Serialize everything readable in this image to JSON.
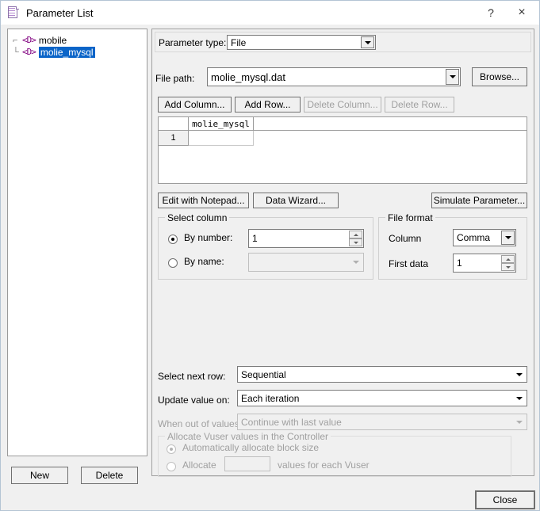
{
  "window": {
    "title": "Parameter List",
    "icon": "parameter-list-icon",
    "help_label": "?",
    "close_glyph": "×"
  },
  "tree": {
    "items": [
      {
        "label": "mobile",
        "glyph": "<D>",
        "selected": false
      },
      {
        "label": "molie_mysql",
        "glyph": "<D>",
        "selected": true
      }
    ]
  },
  "left_buttons": {
    "new_label": "New",
    "delete_label": "Delete"
  },
  "parameter_type": {
    "label": "Parameter type:",
    "value": "File"
  },
  "file_path": {
    "label": "File path:",
    "value": "molie_mysql.dat",
    "browse_label": "Browse..."
  },
  "table_toolbar": {
    "add_column": "Add Column...",
    "add_row": "Add Row...",
    "delete_column": "Delete Column...",
    "delete_row": "Delete Row..."
  },
  "grid": {
    "columns": [
      "molie_mysql"
    ],
    "rows": [
      {
        "number": "1",
        "cells": [
          ""
        ]
      }
    ]
  },
  "data_buttons": {
    "edit_with_notepad": "Edit with Notepad...",
    "data_wizard": "Data Wizard...",
    "simulate_parameter": "Simulate Parameter..."
  },
  "select_column": {
    "legend": "Select column",
    "by_number_label": "By number:",
    "by_number_value": "1",
    "by_number_selected": true,
    "by_name_label": "By name:",
    "by_name_value": "",
    "by_name_selected": false
  },
  "file_format": {
    "legend": "File format",
    "column_label": "Column",
    "column_value": "Comma",
    "first_data_label": "First data",
    "first_data_value": "1"
  },
  "row_options": {
    "select_next_row_label": "Select next row:",
    "select_next_row_value": "Sequential",
    "update_value_on_label": "Update value on:",
    "update_value_on_value": "Each iteration",
    "when_out_of_values_label": "When out of values:",
    "when_out_of_values_value": "Continue with last value"
  },
  "allocate": {
    "legend": "Allocate Vuser values in the Controller",
    "auto_label": "Automatically allocate block size",
    "auto_selected": true,
    "allocate_label": "Allocate",
    "allocate_value": "",
    "allocate_suffix": "values for each Vuser",
    "allocate_selected": false
  },
  "footer": {
    "close_label": "Close"
  }
}
